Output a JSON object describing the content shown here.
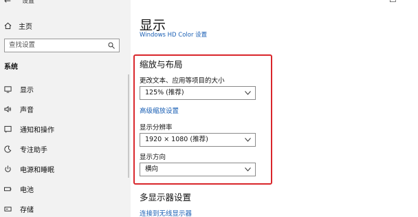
{
  "window": {
    "app_title": "设置",
    "minimize": "—",
    "maximize": "☐"
  },
  "sidebar": {
    "back": "←",
    "home_label": "主页",
    "search_placeholder": "查找设置",
    "section": "系统",
    "items": [
      {
        "label": "显示",
        "icon": "monitor-icon"
      },
      {
        "label": "声音",
        "icon": "speaker-icon"
      },
      {
        "label": "通知和操作",
        "icon": "notification-icon"
      },
      {
        "label": "专注助手",
        "icon": "moon-icon"
      },
      {
        "label": "电源和睡眠",
        "icon": "power-icon"
      },
      {
        "label": "电池",
        "icon": "battery-icon"
      },
      {
        "label": "存储",
        "icon": "storage-icon"
      }
    ]
  },
  "main": {
    "title": "显示",
    "hd_color_link": "Windows HD Color 设置",
    "scale_layout": {
      "title": "缩放与布局",
      "text_size_label": "更改文本、应用等项目的大小",
      "text_size_value": "125% (推荐)",
      "advanced_link": "高级缩放设置",
      "resolution_label": "显示分辨率",
      "resolution_value": "1920 × 1080 (推荐)",
      "orientation_label": "显示方向",
      "orientation_value": "横向"
    },
    "multi_display": {
      "title": "多显示器设置",
      "connect_link": "连接到无线显示器"
    }
  },
  "colors": {
    "highlight": "#d9262b",
    "link": "#1a5fb4"
  }
}
